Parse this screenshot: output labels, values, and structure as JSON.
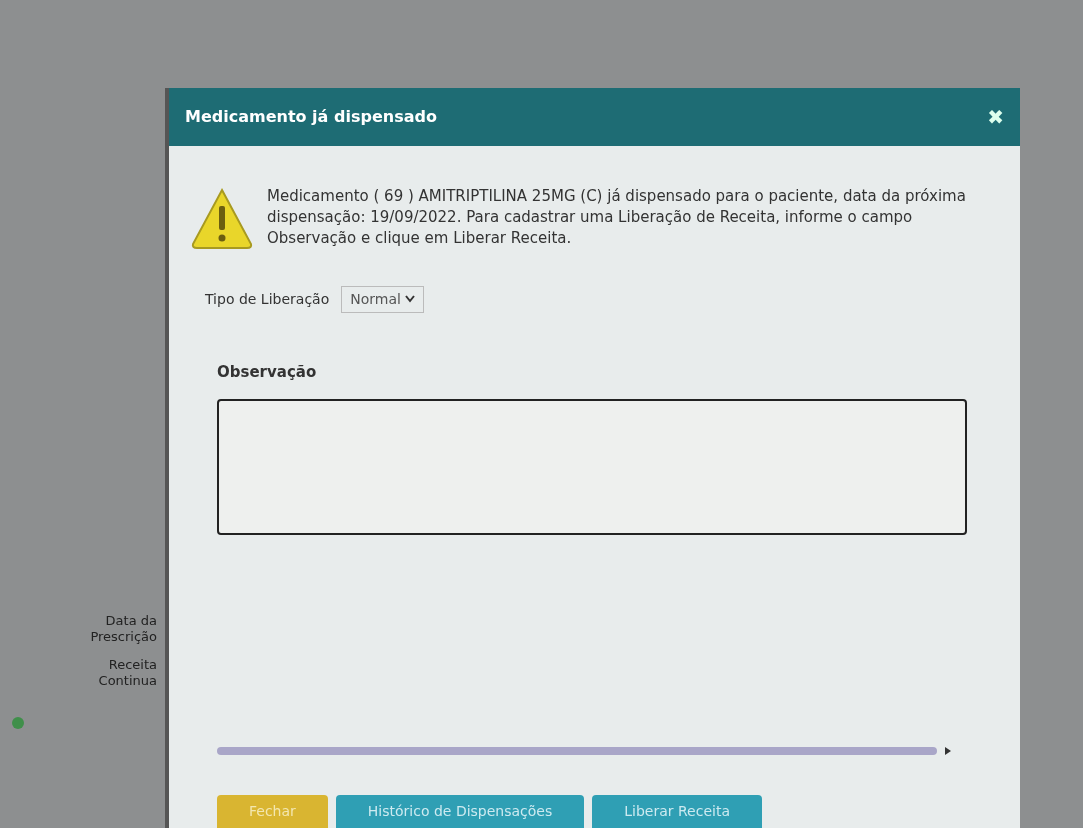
{
  "background_form": {
    "labels": [
      "Data da Prescrição",
      "Receita Continua"
    ]
  },
  "dialog": {
    "title": "Medicamento já dispensado",
    "close": "✖",
    "message": "Medicamento ( 69 ) AMITRIPTILINA 25MG (C) já dispensado para o paciente, data da próxima dispensação: 19/09/2022. Para cadastrar uma Liberação de Receita, informe o campo Observação e clique em Liberar Receita.",
    "tipo_liberacao": {
      "label": "Tipo de Liberação",
      "value": "Normal"
    },
    "observacao": {
      "label": "Observação"
    },
    "buttons": [
      {
        "label": "Fechar",
        "kind": "secondary"
      },
      {
        "label": "Histórico de Dispensações",
        "kind": "primary"
      },
      {
        "label": "Liberar Receita",
        "kind": "primary"
      }
    ]
  }
}
